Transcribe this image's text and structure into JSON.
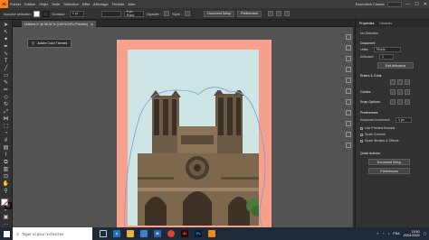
{
  "menubar": {
    "app_logo": "Ai",
    "items": [
      "Fichier",
      "Edition",
      "Objet",
      "Texte",
      "Sélection",
      "Effet",
      "Affichage",
      "Fenêtre",
      "Aide"
    ],
    "workspace_label": "Essentiels Classic",
    "window_controls": [
      "—",
      "☐",
      "✕"
    ]
  },
  "controlbar": {
    "selection_label": "Aucune sélection",
    "stroke_label": "Contour :",
    "stroke_value": "1 pt",
    "brush_label": "5 pt. Rond",
    "opacity_label": "Opacité :",
    "style_label": "Style :",
    "document_setup": "Document Setup",
    "preferences": "Préférences"
  },
  "tab": {
    "title": "Untitled-1* @ 66,02 % (CMYK/GPU Preview)",
    "close": "✕"
  },
  "tooltip": {
    "text": "Adobe Color Themes"
  },
  "tools": [
    "selection",
    "direct-selection",
    "magic-wand",
    "lasso",
    "pen",
    "curvature",
    "type",
    "line",
    "rectangle",
    "paintbrush",
    "shaper",
    "pencil",
    "eraser",
    "rotate",
    "scale",
    "width",
    "free-transform",
    "shape-builder",
    "perspective",
    "mesh",
    "gradient",
    "eyedropper",
    "blend",
    "symbol-sprayer",
    "graph",
    "artboard",
    "slice",
    "hand",
    "zoom"
  ],
  "panel": {
    "tabs": [
      "Properties",
      "Libraries"
    ],
    "no_selection": "No Selection",
    "document_label": "Document",
    "units_label": "Units:",
    "units_value": "Pixels",
    "artboard_label": "Artboard:",
    "artboard_value": "1",
    "edit_artboards": "Edit Artboards",
    "rulers_label": "Rulers & Grids",
    "guides_label": "Guides",
    "snap_label": "Snap Options",
    "preferences_label": "Preferences",
    "keyboard_increment_label": "Keyboard Increment",
    "keyboard_increment_value": "1 px",
    "checkbox_preview_bounds": "Use Preview Bounds",
    "checkbox_scale_corners": "Scale Corners",
    "checkbox_scale_strokes": "Scale Strokes & Effects",
    "quick_actions": "Quick Actions",
    "document_setup": "Document Setup",
    "preferences_button": "Preferences"
  },
  "taskbar": {
    "search_placeholder": "Taper ici pour rechercher",
    "apps": [
      "task-view",
      "edge",
      "explorer",
      "store",
      "mail",
      "chrome",
      "illustrator",
      "photoshop",
      "vlc"
    ],
    "language": "FRA",
    "time": "15:50",
    "date": "20/01/2020"
  },
  "colors": {
    "artboard_border": "#f7a08c",
    "sky": "#cde5e5",
    "guide_path": "#7a9ed8",
    "app_accent": "#ff7f18",
    "taskbar": "#1e2a36"
  }
}
